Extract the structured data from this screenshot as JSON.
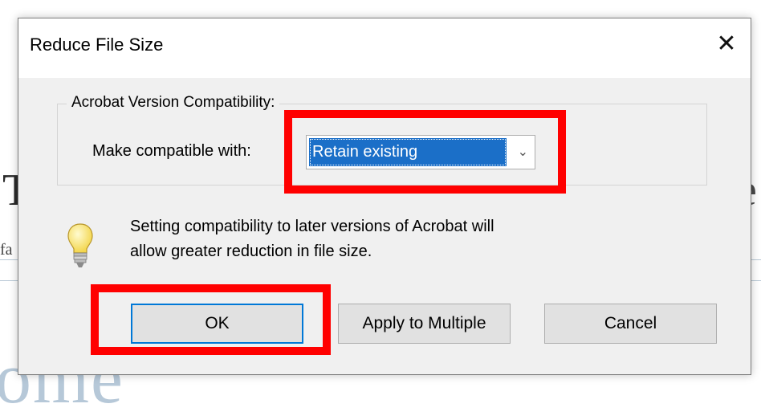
{
  "dialog": {
    "title": "Reduce File Size",
    "close_glyph": "✕",
    "group_label": "Acrobat Version Compatibility:",
    "make_compatible_label": "Make compatible with:",
    "compatibility_select": {
      "selected": "Retain existing",
      "arrow_glyph": "⌄"
    },
    "info_icon": "lightbulb-icon",
    "info_text_line1": "Setting compatibility to later versions of Acrobat will",
    "info_text_line2": "allow greater reduction in file size.",
    "buttons": {
      "ok": "OK",
      "apply_multiple": "Apply to Multiple",
      "cancel": "Cancel"
    }
  },
  "colors": {
    "highlight": "#ff0000",
    "selection": "#1b6fc8",
    "default_button_border": "#0078d7"
  }
}
